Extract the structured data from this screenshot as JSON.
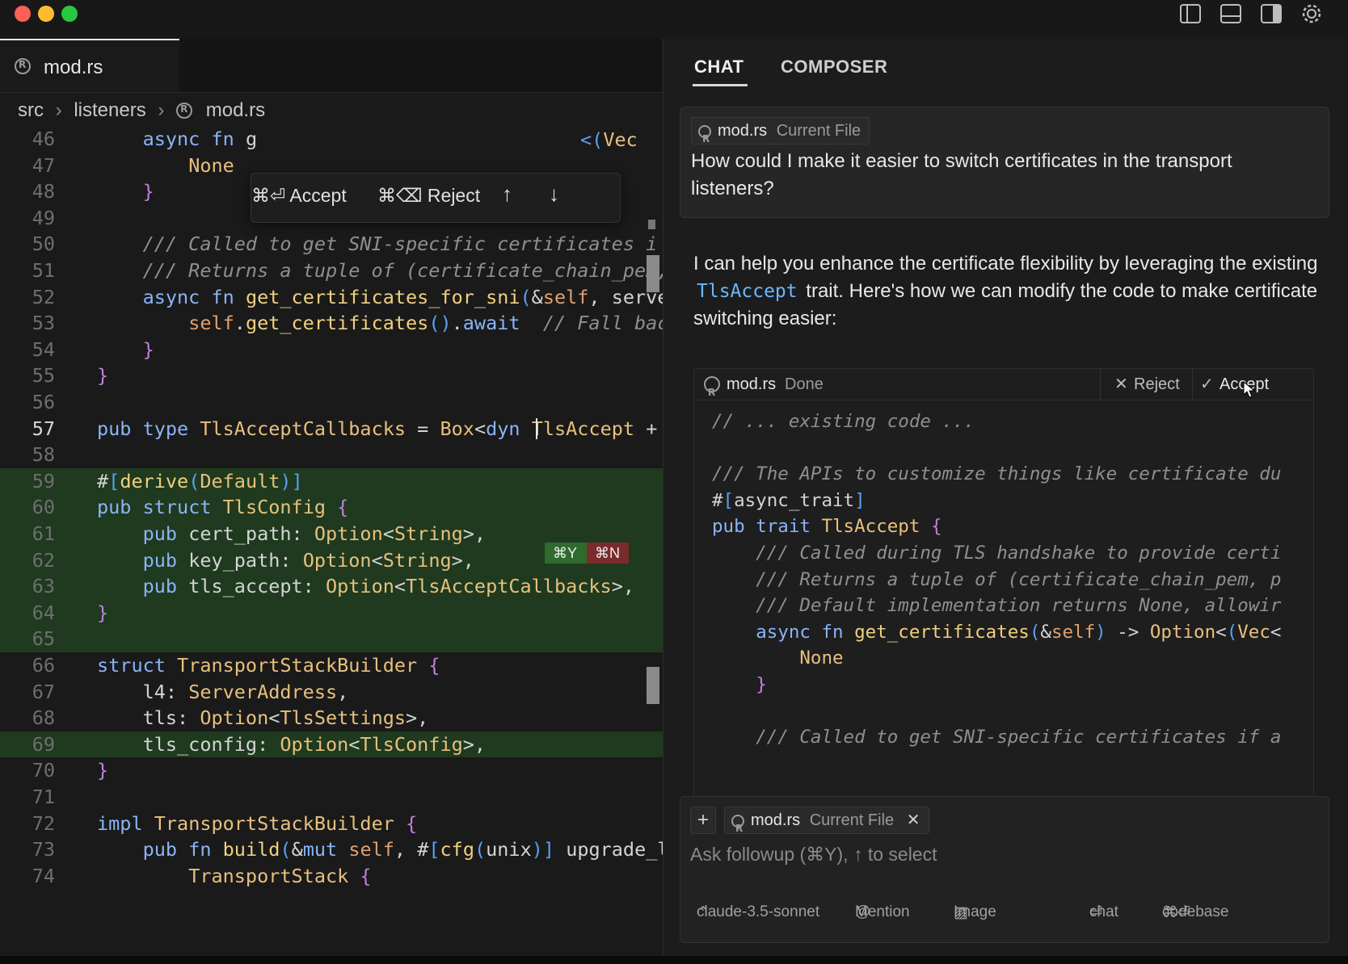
{
  "window": {
    "traffic_lights": [
      "#fe5f57",
      "#febc2e",
      "#28c840"
    ],
    "toolbar_icons": [
      "sidebar-left-icon",
      "panel-bottom-icon",
      "sidebar-right-icon",
      "gear-icon"
    ]
  },
  "editor": {
    "tab_label": "mod.rs",
    "breadcrumb": [
      "src",
      "listeners",
      "mod.rs"
    ],
    "diff_bar": {
      "accept": "⌘⏎ Accept",
      "reject": "⌘⌫ Reject",
      "up": "↑",
      "down": "↓"
    },
    "hunk_tags": {
      "accept": "⌘Y",
      "reject": "⌘N"
    },
    "line_numbers": [
      "46",
      "47",
      "48",
      "49",
      "50",
      "51",
      "52",
      "53",
      "54",
      "55",
      "56",
      "57",
      "58",
      "59",
      "60",
      "61",
      "62",
      "63",
      "64",
      "65",
      "66",
      "67",
      "68",
      "69",
      "70",
      "71",
      "72",
      "73",
      "74"
    ],
    "lines": [
      "    async fn g",
      "        None",
      "    }",
      "",
      "    /// Called to get SNI-specific certificates i",
      "    /// Returns a tuple of (certificate_chain_pem,",
      "    async fn get_certificates_for_sni(&self, serve",
      "        self.get_certificates().await  // Fall bac",
      "    }",
      "}",
      "",
      "pub type TlsAcceptCallbacks = Box<dyn TlsAccept + S",
      "",
      "#[derive(Default)]",
      "pub struct TlsConfig {",
      "    pub cert_path: Option<String>,",
      "    pub key_path: Option<String>,",
      "    pub tls_accept: Option<TlsAcceptCallbacks>,",
      "}",
      "",
      "struct TransportStackBuilder {",
      "    l4: ServerAddress,",
      "    tls: Option<TlsSettings>,",
      "    tls_config: Option<TlsConfig>,",
      "}",
      "",
      "impl TransportStackBuilder {",
      "    pub fn build(&mut self, #[cfg(unix)] upgrade_li",
      "        TransportStack {"
    ],
    "line47_tail": "<(Vec"
  },
  "chat": {
    "tabs": [
      "CHAT",
      "COMPOSER"
    ],
    "user_message": {
      "file_chip": "mod.rs",
      "file_chip_tag": "Current File",
      "text": "How could I make it easier to switch certificates in the transport listeners?"
    },
    "response": {
      "text_before": "I can help you enhance the certificate flexibility by leveraging the existing ",
      "code_ref": "TlsAccept",
      "text_after": " trait. Here's how we can modify the code to make certificate switching easier:"
    },
    "code_block": {
      "file": "mod.rs",
      "status": "Done",
      "reject_label": "Reject",
      "accept_label": "Accept",
      "lines": [
        "// ... existing code ...",
        "",
        "/// The APIs to customize things like certificate du",
        "#[async_trait]",
        "pub trait TlsAccept {",
        "    /// Called during TLS handshake to provide certi",
        "    /// Returns a tuple of (certificate_chain_pem, p",
        "    /// Default implementation returns None, allowir",
        "    async fn get_certificates(&self) -> Option<(Vec<",
        "        None",
        "    }",
        "",
        "    /// Called to get SNI-specific certificates if a"
      ]
    },
    "input": {
      "add_button": "+",
      "file_chip": "mod.rs",
      "file_chip_tag": "Current File",
      "placeholder": "Ask followup (⌘Y), ↑ to select",
      "model": "claude-3.5-sonnet",
      "mention": "Mention",
      "image": "Image",
      "chat": "chat",
      "codebase": "codebase"
    }
  }
}
